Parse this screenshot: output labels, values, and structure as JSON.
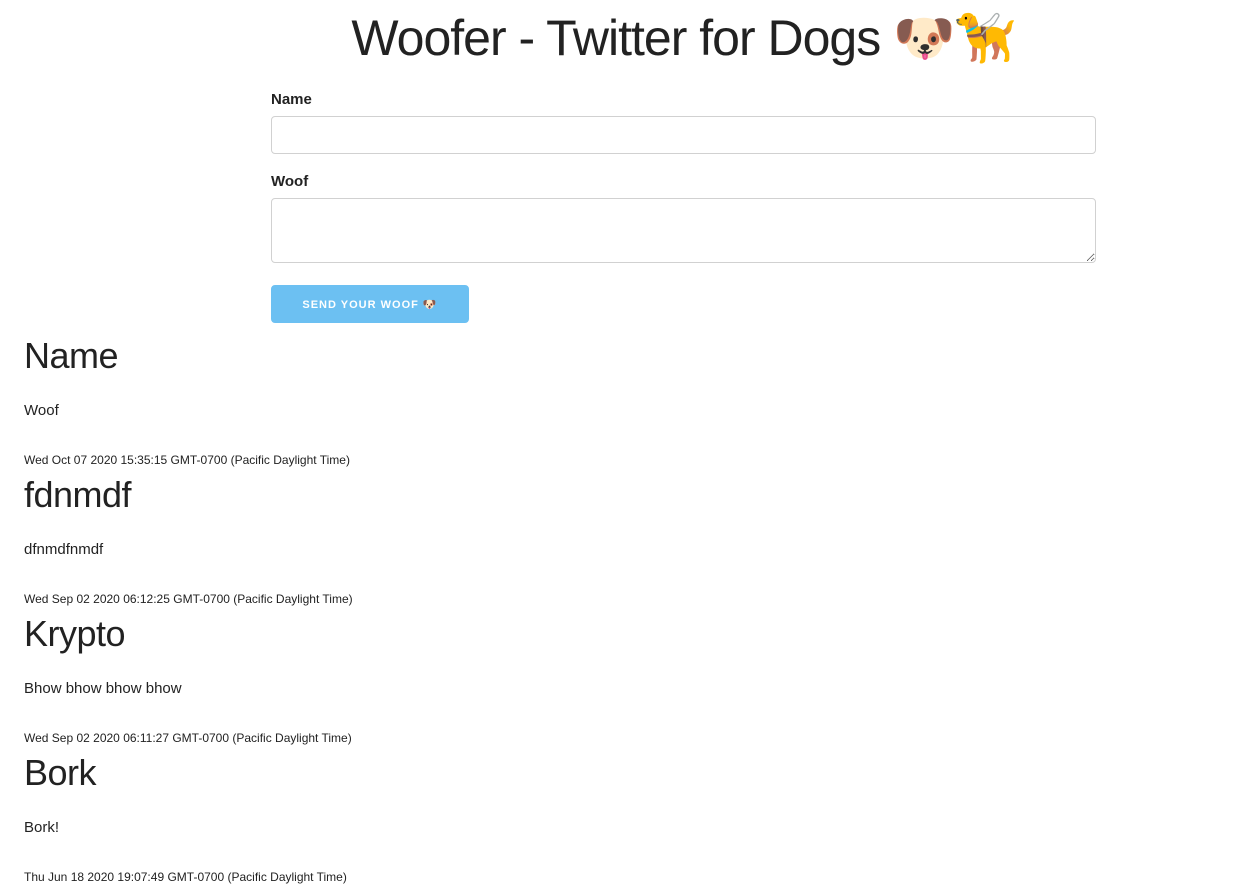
{
  "header": {
    "title": "Woofer - Twitter for Dogs 🐶🦮"
  },
  "form": {
    "name_label": "Name",
    "name_value": "",
    "woof_label": "Woof",
    "woof_value": "",
    "submit_label": "Send your woof 🐶"
  },
  "woofs": [
    {
      "name": "Name",
      "text": "Woof",
      "time": "Wed Oct 07 2020 15:35:15 GMT-0700 (Pacific Daylight Time)"
    },
    {
      "name": "fdnmdf",
      "text": "dfnmdfnmdf",
      "time": "Wed Sep 02 2020 06:12:25 GMT-0700 (Pacific Daylight Time)"
    },
    {
      "name": "Krypto",
      "text": "Bhow bhow bhow bhow",
      "time": "Wed Sep 02 2020 06:11:27 GMT-0700 (Pacific Daylight Time)"
    },
    {
      "name": "Bork",
      "text": "Bork!",
      "time": "Thu Jun 18 2020 19:07:49 GMT-0700 (Pacific Daylight Time)"
    }
  ],
  "colors": {
    "button_bg": "#6cc0f2",
    "text": "#222222",
    "input_border": "#d1d1d1"
  }
}
